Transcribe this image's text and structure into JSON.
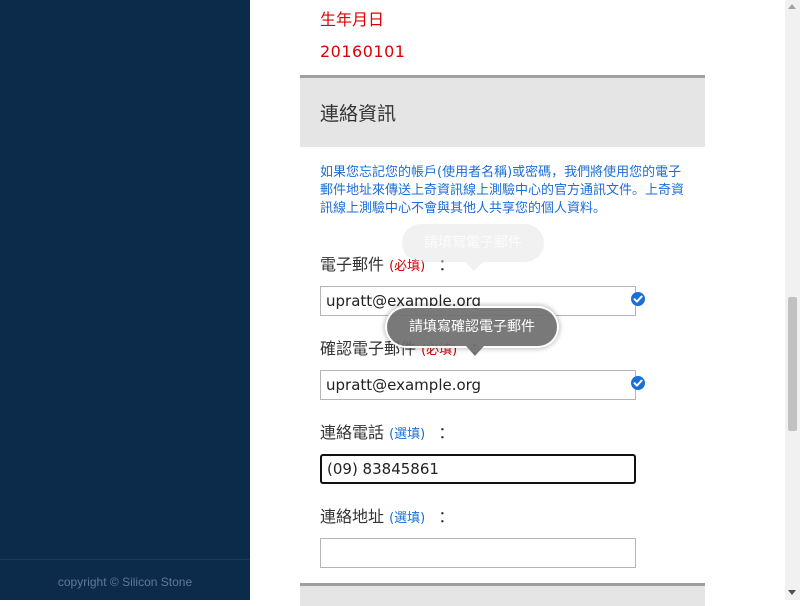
{
  "sidebar": {
    "copyright": "copyright © Silicon Stone"
  },
  "birth": {
    "label": "生年月日",
    "value": "20160101"
  },
  "contact": {
    "title": "連絡資訊",
    "info": "如果您忘記您的帳戶(使用者名稱)或密碼，我們將使用您的電子郵件地址來傳送上奇資訊線上測驗中心的官方通訊文件。上奇資訊線上測驗中心不會與其他人共享您的個人資料。",
    "colon": "：",
    "fields": {
      "email": {
        "label": "電子郵件",
        "tag": "(必填)",
        "value": "upratt@example.org",
        "tooltip": "請填寫電子郵件"
      },
      "confirm_email": {
        "label": "確認電子郵件",
        "tag": "(必填)",
        "value": "upratt@example.org",
        "tooltip": "請填寫確認電子郵件"
      },
      "phone": {
        "label": "連絡電話",
        "tag": "(選填)",
        "value": "(09) 83845861"
      },
      "address": {
        "label": "連絡地址",
        "tag": "(選填)",
        "value": ""
      }
    }
  },
  "colors": {
    "sidebar_bg": "#0c2a4a",
    "required": "#cc0000",
    "optional": "#1a6ed8",
    "check": "#1a6ed8"
  },
  "icons": {
    "valid": "check-circle-icon"
  }
}
